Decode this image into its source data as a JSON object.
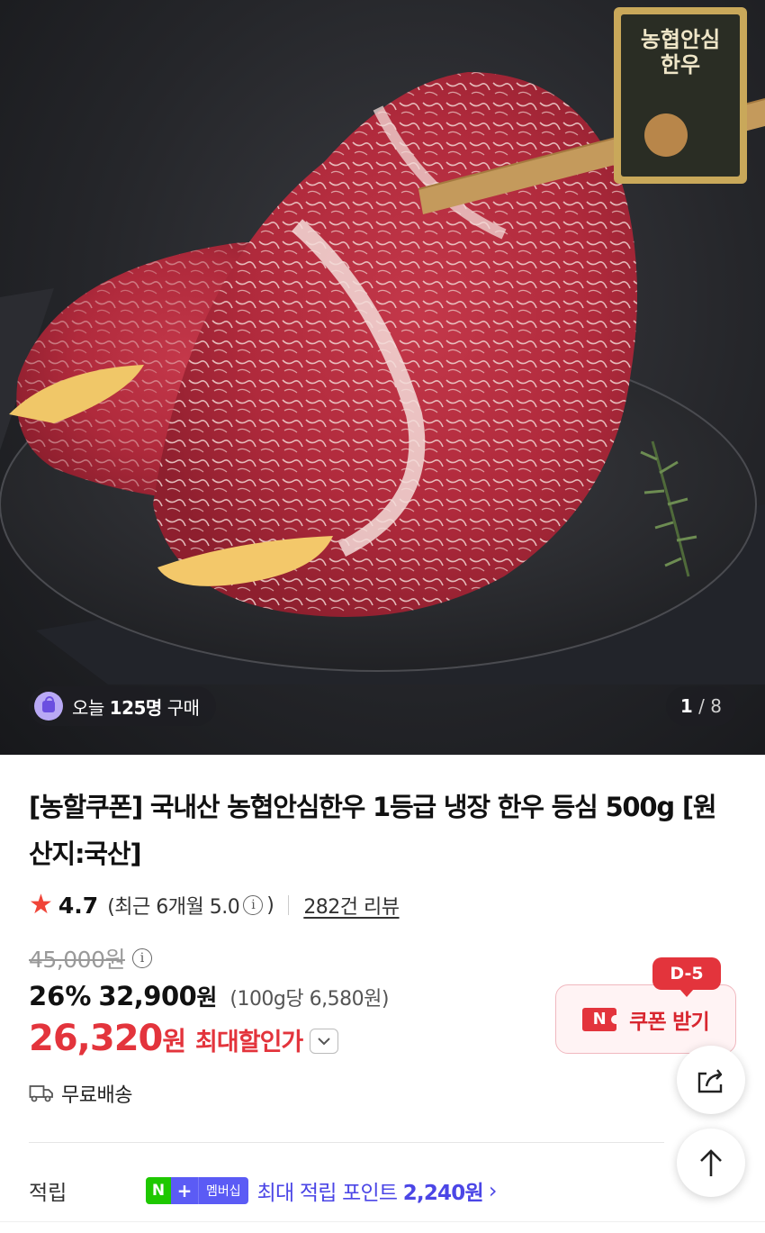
{
  "hero": {
    "badge_text": "농협안심한우",
    "today_prefix": "오늘",
    "today_count": "125명",
    "today_suffix": "구매",
    "page_current": "1",
    "page_total": "/ 8"
  },
  "product": {
    "title": "[농할쿠폰] 국내산 농협안심한우 1등급 냉장 한우 등심 500g [원산지:국산]",
    "rating": "4.7",
    "recent_rating": "(최근 6개월 5.0",
    "recent_close": ")",
    "review_count": "282건 리뷰"
  },
  "price": {
    "original": "45,000원",
    "discount_percent": "26%",
    "sale_price": "32,900",
    "sale_unit": "원",
    "unit_price": "(100g당 6,580원)",
    "max_price": "26,320",
    "max_unit": "원",
    "max_label": "최대할인가"
  },
  "coupon": {
    "dday": "D-5",
    "label": "쿠폰 받기",
    "badge": "N"
  },
  "shipping": {
    "label": "무료배송"
  },
  "points": {
    "label": "적립",
    "membership_n": "N",
    "membership_plus": "+",
    "membership_text": "멤버십",
    "text_prefix": "최대 적립 포인트",
    "amount": "2,240원"
  },
  "colors": {
    "accent_red": "#e3343c",
    "points_blue": "#4b46e6",
    "naver_green": "#1ec800"
  }
}
